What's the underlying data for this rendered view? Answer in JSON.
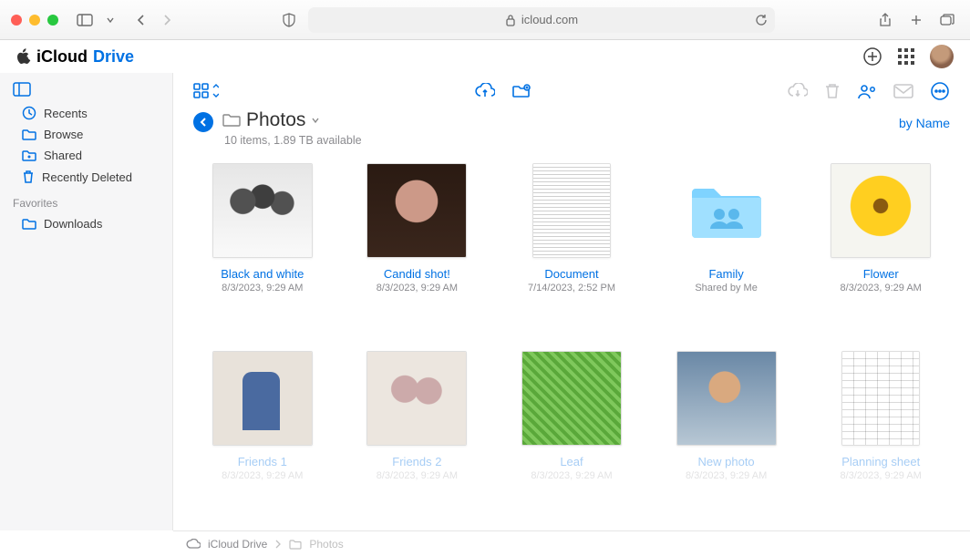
{
  "browser": {
    "url_host": "icloud.com"
  },
  "brand": {
    "name": "iCloud",
    "suffix": "Drive"
  },
  "sidebar": {
    "items": [
      {
        "label": "Recents"
      },
      {
        "label": "Browse"
      },
      {
        "label": "Shared"
      },
      {
        "label": "Recently Deleted"
      }
    ],
    "favorites_header": "Favorites",
    "favorites": [
      {
        "label": "Downloads"
      }
    ]
  },
  "folder": {
    "title": "Photos",
    "subtitle": "10 items, 1.89 TB available",
    "sort_label": "by Name"
  },
  "items": [
    {
      "name": "Black and white",
      "meta": "8/3/2023, 9:29 AM",
      "thumb": "bw"
    },
    {
      "name": "Candid shot!",
      "meta": "8/3/2023, 9:29 AM",
      "thumb": "candid"
    },
    {
      "name": "Document",
      "meta": "7/14/2023, 2:52 PM",
      "thumb": "doc"
    },
    {
      "name": "Family",
      "meta": "Shared by Me",
      "thumb": "folder"
    },
    {
      "name": "Flower",
      "meta": "8/3/2023, 9:29 AM",
      "thumb": "flower"
    },
    {
      "name": "Friends 1",
      "meta": "8/3/2023, 9:29 AM",
      "thumb": "friends1"
    },
    {
      "name": "Friends 2",
      "meta": "8/3/2023, 9:29 AM",
      "thumb": "friends2"
    },
    {
      "name": "Leaf",
      "meta": "8/3/2023, 9:29 AM",
      "thumb": "leaf"
    },
    {
      "name": "New photo",
      "meta": "8/3/2023, 9:29 AM",
      "thumb": "newphoto"
    },
    {
      "name": "Planning sheet",
      "meta": "8/3/2023, 9:29 AM",
      "thumb": "sheet"
    }
  ],
  "breadcrumb": {
    "root": "iCloud Drive",
    "leaf": "Photos"
  }
}
